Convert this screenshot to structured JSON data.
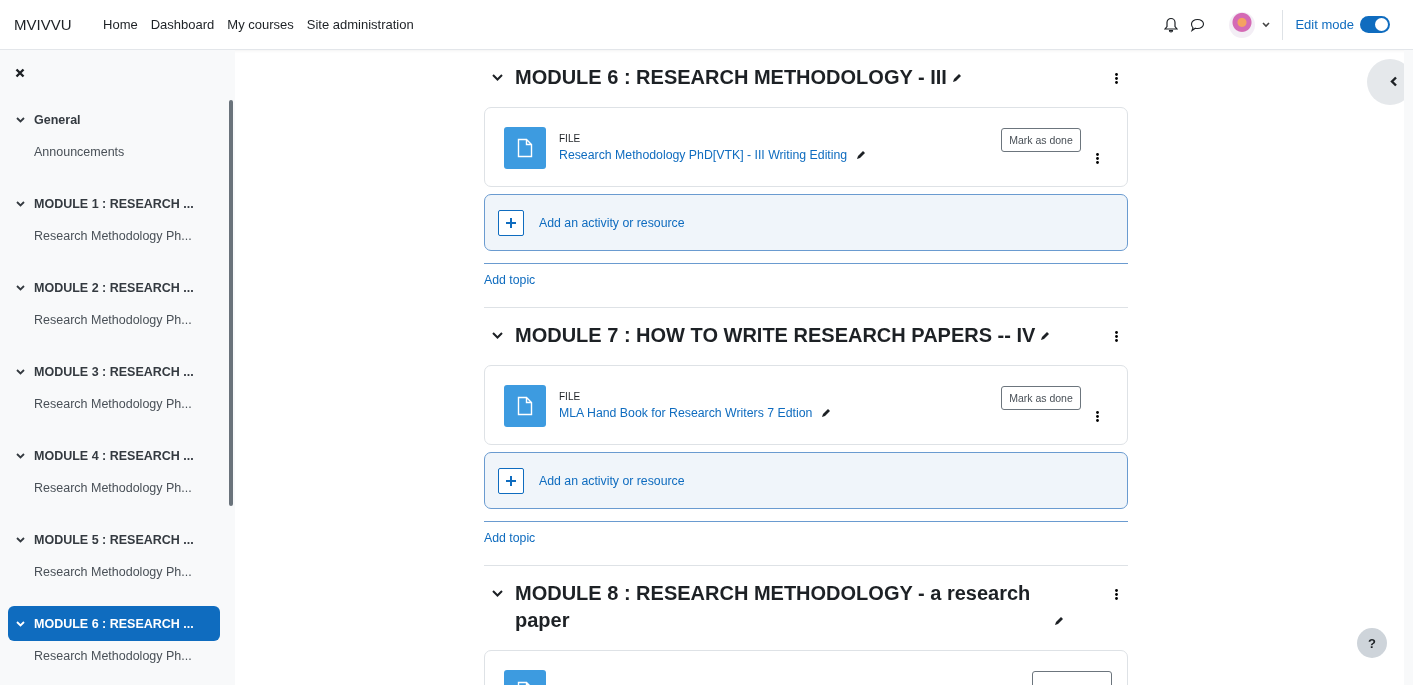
{
  "navbar": {
    "site_name": "MVIVVU",
    "links": [
      "Home",
      "Dashboard",
      "My courses",
      "Site administration"
    ],
    "edit_mode": {
      "label": "Edit mode",
      "on": true
    }
  },
  "course_index": {
    "sections": [
      {
        "title": "General",
        "expanded": true,
        "selected": false,
        "children": [
          "Announcements"
        ]
      },
      {
        "title": "MODULE 1 : RESEARCH ...",
        "expanded": true,
        "selected": false,
        "children": [
          "Research Methodology Ph..."
        ]
      },
      {
        "title": "MODULE 2 : RESEARCH ...",
        "expanded": true,
        "selected": false,
        "children": [
          "Research Methodology Ph..."
        ]
      },
      {
        "title": "MODULE 3 : RESEARCH ...",
        "expanded": true,
        "selected": false,
        "children": [
          "Research Methodology Ph..."
        ]
      },
      {
        "title": "MODULE 4 : RESEARCH ...",
        "expanded": true,
        "selected": false,
        "children": [
          "Research Methodology Ph..."
        ]
      },
      {
        "title": "MODULE 5 : RESEARCH ...",
        "expanded": true,
        "selected": false,
        "children": [
          "Research Methodology Ph..."
        ]
      },
      {
        "title": "MODULE 6 : RESEARCH ...",
        "expanded": true,
        "selected": true,
        "children": [
          "Research Methodology Ph..."
        ]
      }
    ]
  },
  "sections": [
    {
      "title": "MODULE 6 : RESEARCH METHODOLOGY - III",
      "expanded": true,
      "activities": [
        {
          "kind": "file",
          "type_label": "FILE",
          "name": "Research Methodology PhD[VTK] - III Writing Editing",
          "button": "Mark as done"
        }
      ],
      "add_activity": "Add an activity or resource",
      "add_topic": "Add topic"
    },
    {
      "title": "MODULE 7 : HOW TO WRITE RESEARCH PAPERS -- IV",
      "expanded": true,
      "activities": [
        {
          "kind": "file",
          "type_label": "FILE",
          "name": "MLA Hand Book for Research Writers 7 Edtion",
          "button": "Mark as done"
        }
      ],
      "add_activity": "Add an activity or resource",
      "add_topic": "Add topic"
    },
    {
      "title": "MODULE 8 : RESEARCH METHODOLOGY - a research paper",
      "expanded": true,
      "activities": [
        {
          "kind": "file"
        }
      ]
    }
  ],
  "help_button": "?"
}
